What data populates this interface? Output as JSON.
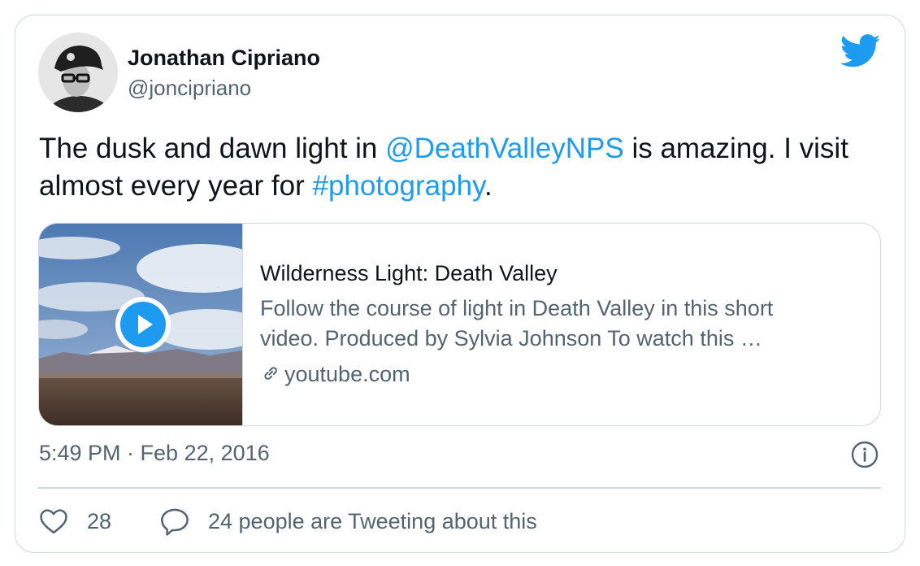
{
  "author": {
    "name": "Jonathan Cipriano",
    "handle": "@joncipriano",
    "avatar_alt": "avatar"
  },
  "tweet": {
    "text_part1": "The dusk and dawn light in ",
    "mention": "@DeathValleyNPS",
    "text_part2": " is amazing. I visit almost every year for ",
    "hashtag": "#photography",
    "text_part3": "."
  },
  "preview": {
    "title": "Wilderness Light: Death Valley",
    "description_line1": "Follow the course of light in Death Valley in this short",
    "description_line2": "video. Produced by Sylvia Johnson To watch this …",
    "domain": "youtube.com",
    "thumbnail": "desert-landscape-video-thumbnail"
  },
  "timestamp": "5:49 PM · Feb 22, 2016",
  "actions": {
    "like_count": "28",
    "reply_label": "24 people are Tweeting about this"
  },
  "icons": {
    "brand": "twitter-bird-icon",
    "info": "info-icon",
    "like": "heart-icon",
    "reply": "speech-bubble-icon",
    "link": "link-icon",
    "play": "play-icon"
  },
  "colors": {
    "accent": "#1d9bf0",
    "text": "#0f1419",
    "secondary": "#536471",
    "border": "#cfd9de"
  }
}
